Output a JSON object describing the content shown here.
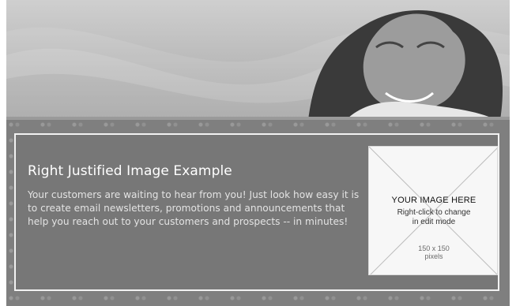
{
  "email_template": {
    "title": "Right Justified Image Example",
    "body_text": "Your customers are waiting to hear from you! Just look how easy it is to create email newsletters, promotions and announcements that help you reach out to your customers and prospects -- in minutes!",
    "image_placeholder": {
      "heading": "YOUR IMAGE HERE",
      "line1": "Right-click to change",
      "line2": "in edit mode",
      "size_line1": "150 x 150",
      "size_line2": "pixels"
    }
  },
  "colors": {
    "content_bg": "#777777",
    "text_primary": "#ffffff",
    "text_secondary": "#e3e3e3"
  }
}
